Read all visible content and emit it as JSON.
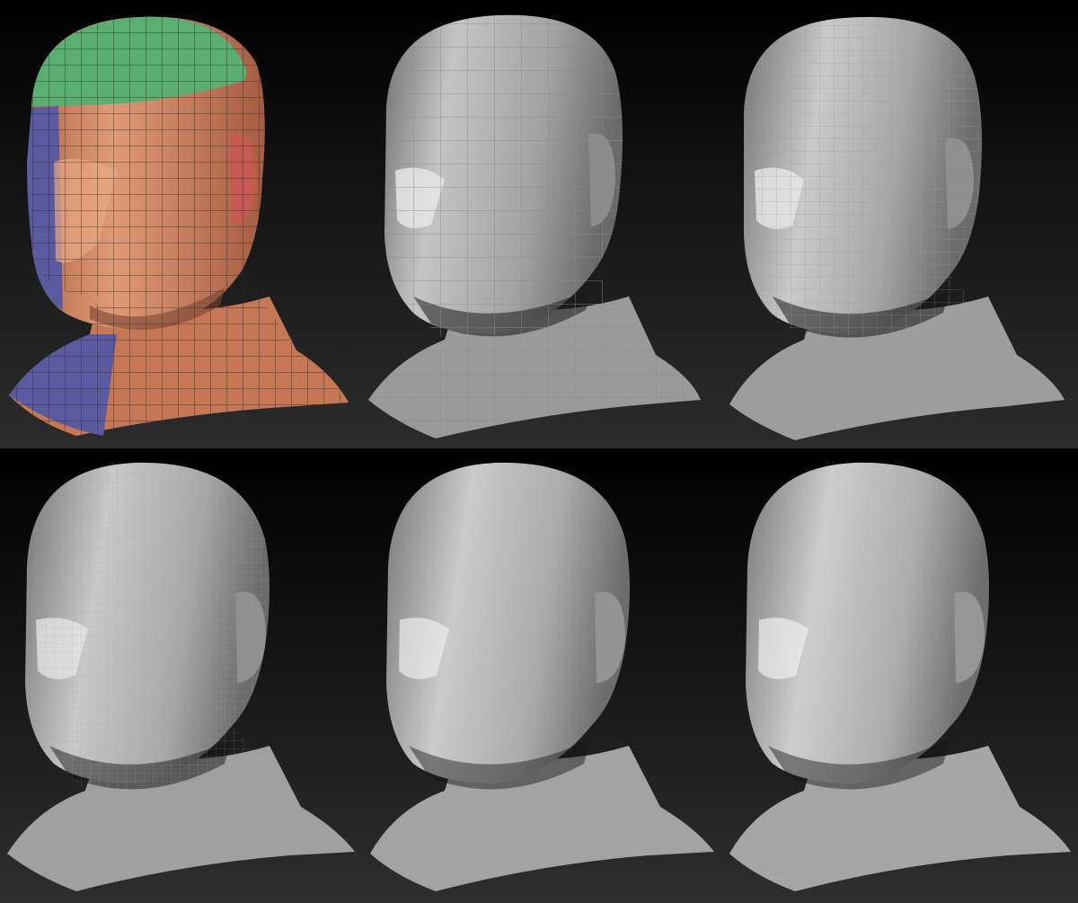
{
  "sheet": {
    "description_visible_text": "",
    "rows": [
      {
        "stages": [
          {
            "icon": "polygroup-base-mesh-icon",
            "subdivision_level": 1,
            "colors": [
              "#5aae72",
              "#5b5aa0",
              "#d28664"
            ]
          },
          {
            "icon": "low-poly-head-icon",
            "subdivision_level": 2,
            "colors": [
              "#a9a9a9"
            ]
          },
          {
            "icon": "faceted-head-icon",
            "subdivision_level": 3,
            "colors": [
              "#ababab"
            ]
          }
        ]
      },
      {
        "stages": [
          {
            "icon": "mid-res-head-icon",
            "subdivision_level": 4,
            "colors": [
              "#ababab"
            ]
          },
          {
            "icon": "detailed-head-icon",
            "subdivision_level": 5,
            "colors": [
              "#ababab"
            ]
          },
          {
            "icon": "smooth-head-icon",
            "subdivision_level": 6,
            "colors": [
              "#ababab"
            ]
          }
        ]
      }
    ]
  }
}
